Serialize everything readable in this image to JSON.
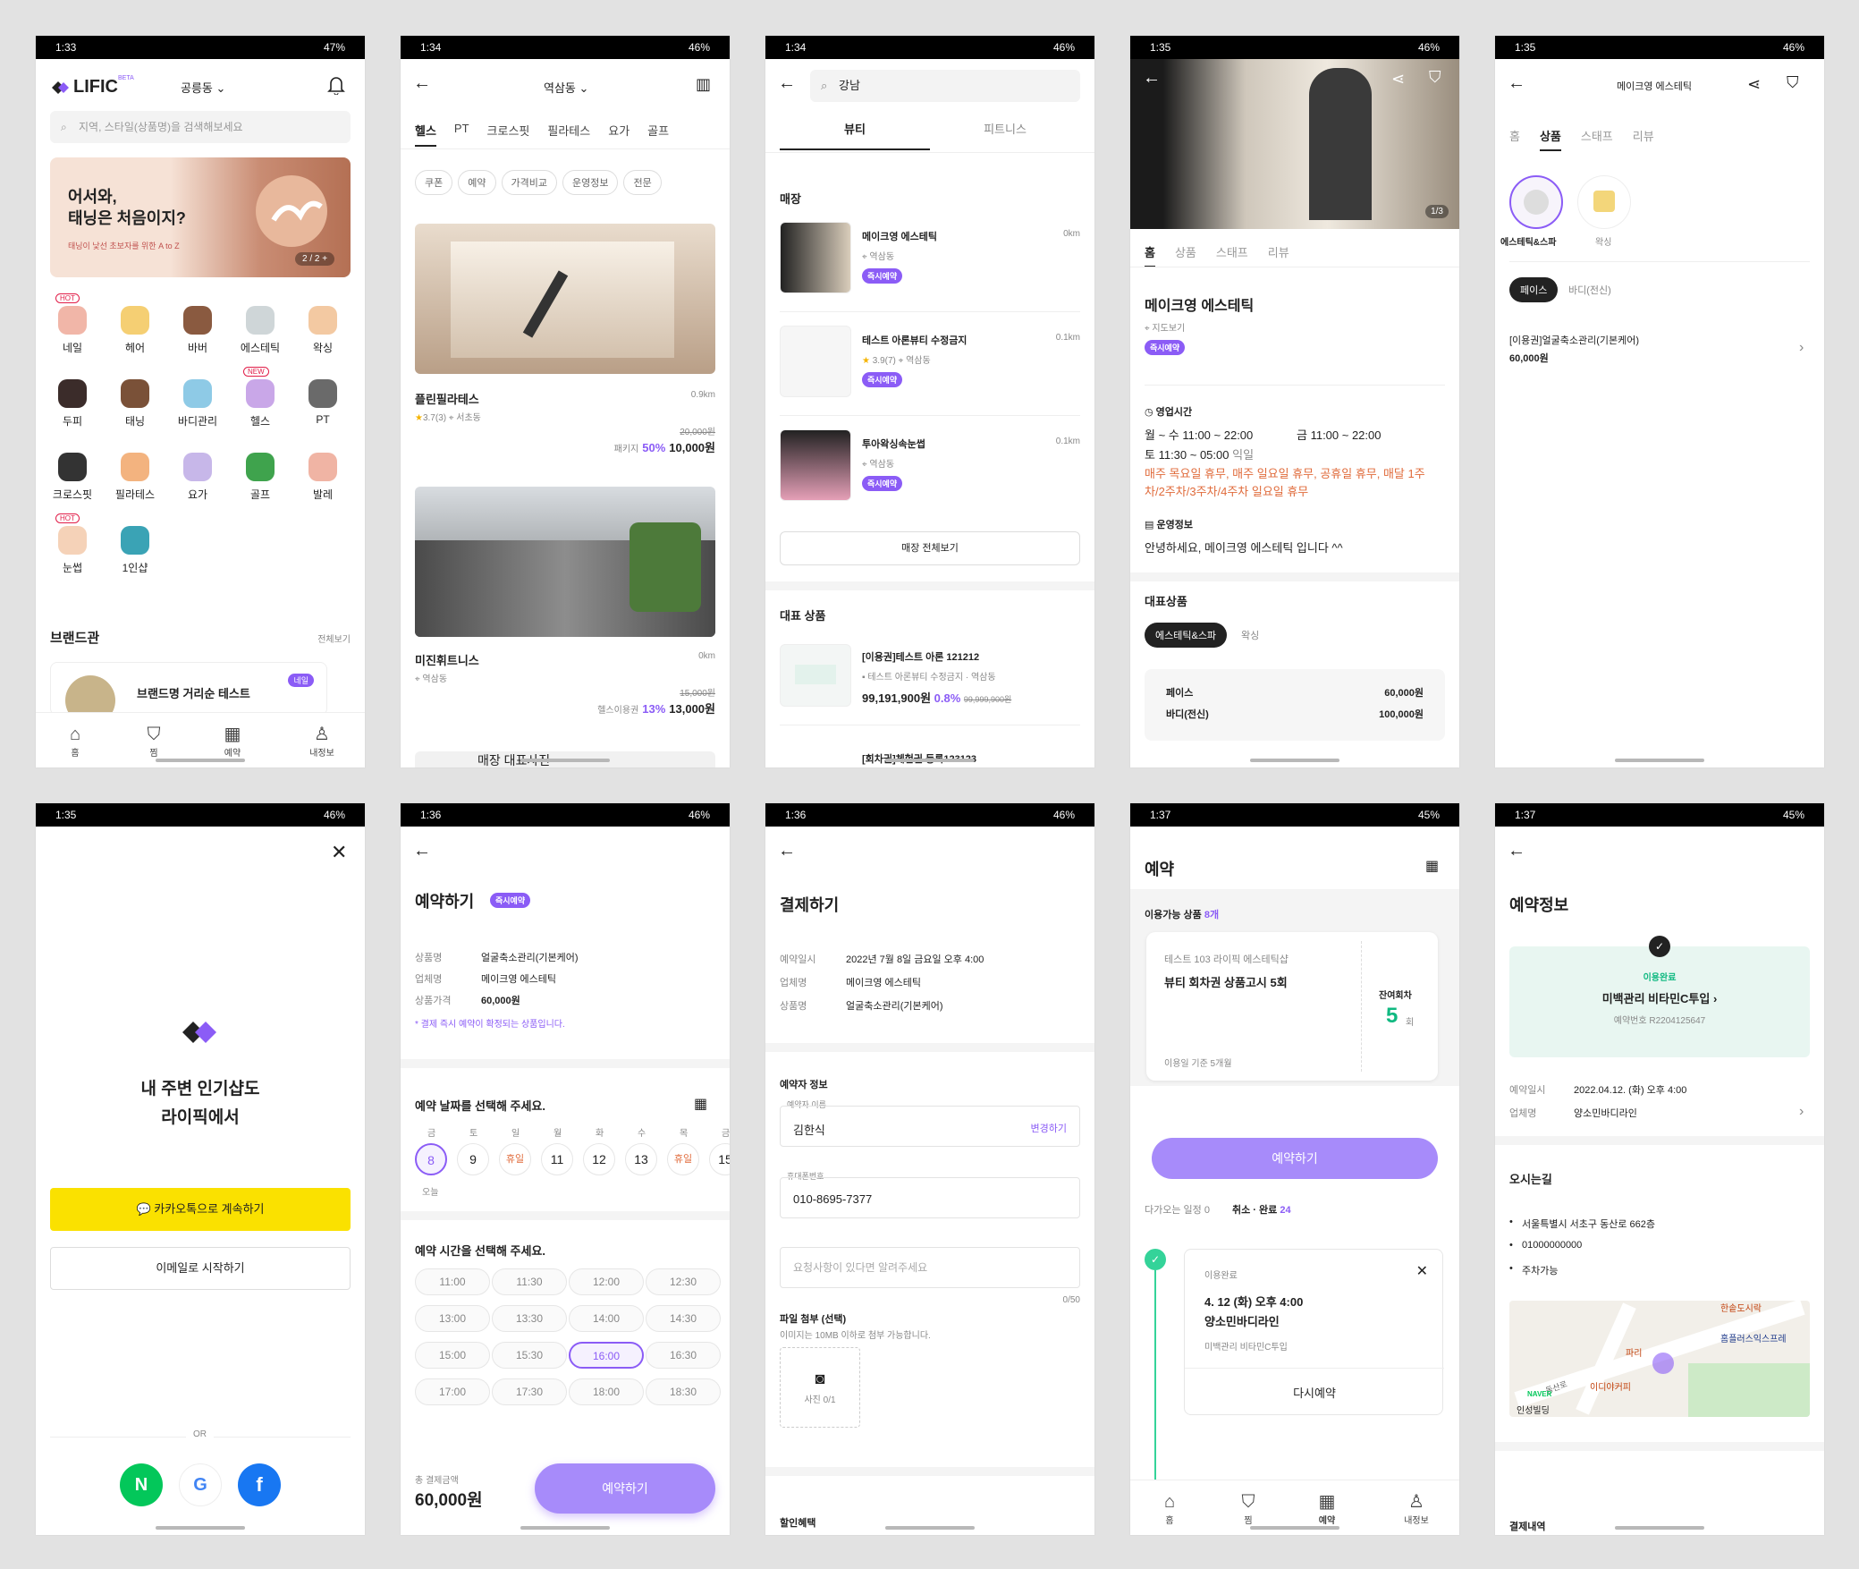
{
  "colors": {
    "accent": "#8b5cf6",
    "kakao": "#fae100",
    "naver": "#03c75a",
    "facebook": "#1877f2",
    "mint": "#e8f6f1"
  },
  "s1": {
    "status": {
      "time": "1:33",
      "battery": "47%"
    },
    "logo": "LIFIC",
    "beta": "BETA",
    "location": "공릉동",
    "search_placeholder": "지역, 스타일(상품명)을 검색해보세요",
    "banner": {
      "title1": "어서와,",
      "title2": "태닝은 처음이지?",
      "sub": "태닝이 낯선 초보자를 위한 A to Z",
      "counter": "2 / 2 +"
    },
    "cats": [
      {
        "label": "네일",
        "tag": "HOT"
      },
      {
        "label": "헤어",
        "tag": ""
      },
      {
        "label": "바버",
        "tag": ""
      },
      {
        "label": "에스테틱",
        "tag": ""
      },
      {
        "label": "왁싱",
        "tag": ""
      },
      {
        "label": "두피",
        "tag": ""
      },
      {
        "label": "태닝",
        "tag": ""
      },
      {
        "label": "바디관리",
        "tag": ""
      },
      {
        "label": "헬스",
        "tag": "NEW"
      },
      {
        "label": "PT",
        "tag": ""
      },
      {
        "label": "크로스핏",
        "tag": ""
      },
      {
        "label": "필라테스",
        "tag": ""
      },
      {
        "label": "요가",
        "tag": ""
      },
      {
        "label": "골프",
        "tag": ""
      },
      {
        "label": "발레",
        "tag": ""
      },
      {
        "label": "눈썹",
        "tag": "HOT"
      },
      {
        "label": "1인샵",
        "tag": ""
      }
    ],
    "brand_title": "브랜드관",
    "brand_all": "전체보기",
    "brand_card": "브랜드명 거리순 테스트",
    "brand_tag": "네일",
    "nav": [
      "홈",
      "찜",
      "예약",
      "내정보"
    ]
  },
  "s2": {
    "status": {
      "time": "1:34",
      "battery": "46%"
    },
    "location": "역삼동",
    "tabs": [
      "헬스",
      "PT",
      "크로스핏",
      "필라테스",
      "요가",
      "골프"
    ],
    "filters": [
      "쿠폰",
      "예약",
      "가격비교",
      "운영정보",
      "전문"
    ],
    "items": [
      {
        "name": "플린필라테스",
        "dist": "0.9km",
        "rating": "3.7(3)",
        "loc": "서초동",
        "orig": "20,000원",
        "kind": "패키지",
        "pct": "50%",
        "price": "10,000원"
      },
      {
        "name": "미진휘트니스",
        "dist": "0km",
        "rating": "",
        "loc": "역삼동",
        "orig": "15,000원",
        "kind": "헬스이용권",
        "pct": "13%",
        "price": "13,000원"
      }
    ],
    "bottom": "매장 대표사진"
  },
  "s3": {
    "status": {
      "time": "1:34",
      "battery": "46%"
    },
    "search": "강남",
    "tabs": [
      "뷰티",
      "피트니스"
    ],
    "store_title": "매장",
    "stores": [
      {
        "name": "메이크영 에스테틱",
        "dist": "0km",
        "loc": "역삼동",
        "rating": "",
        "tag": "즉시예약"
      },
      {
        "name": "테스트 아론뷰티 수정금지",
        "dist": "0.1km",
        "loc": "역삼동",
        "rating": "3.9(7)",
        "tag": "즉시예약"
      },
      {
        "name": "투아왁싱속눈썹",
        "dist": "0.1km",
        "loc": "역삼동",
        "rating": "",
        "tag": "즉시예약"
      }
    ],
    "all_btn": "매장 전체보기",
    "prod_title": "대표 상품",
    "prod": {
      "name": "[이용권]테스트 아론 121212",
      "sub": "테스트 아론뷰티 수정금지",
      "loc": "역삼동",
      "price": "99,191,900원",
      "pct": "0.8%",
      "orig": "99,999,900원"
    },
    "prod2": "[회차권]체험권 등록123123"
  },
  "s4": {
    "status": {
      "time": "1:35",
      "battery": "46%"
    },
    "counter": "1/3",
    "tabs": [
      "홈",
      "상품",
      "스태프",
      "리뷰"
    ],
    "name": "메이크영 에스테틱",
    "map": "지도보기",
    "tag": "즉시예약",
    "hours_title": "영업시간",
    "h1a": "월 ~ 수 11:00 ~ 22:00",
    "h1b": "금 11:00 ~ 22:00",
    "h2": "토 11:30 ~ 05:00",
    "h2b": "익일",
    "holiday": "매주 목요일 휴무, 매주 일요일 휴무, 공휴일 휴무, 매달 1주차/2주차/3주차/4주차 일요일 휴무",
    "info_title": "운영정보",
    "info": "안녕하세요, 메이크영 에스테틱 입니다 ^^",
    "rep_title": "대표상품",
    "chips": [
      "에스테틱&스파",
      "왁싱"
    ],
    "menu": [
      {
        "name": "페이스",
        "price": "60,000원"
      },
      {
        "name": "바디(전신)",
        "price": "100,000원"
      }
    ]
  },
  "s5": {
    "status": {
      "time": "1:35",
      "battery": "46%"
    },
    "title": "메이크영 에스테틱",
    "tabs": [
      "홈",
      "상품",
      "스태프",
      "리뷰"
    ],
    "cats": [
      "에스테틱&스파",
      "왁싱"
    ],
    "sub": [
      "페이스",
      "바디(전신)"
    ],
    "item": "[이용권]얼굴축소관리(기본케어)",
    "price": "60,000원"
  },
  "s6": {
    "status": {
      "time": "1:35",
      "battery": "46%"
    },
    "line1": "내 주변 인기샵도",
    "line2": "라이픽에서",
    "kakao": "카카오톡으로 계속하기",
    "email": "이메일로 시작하기",
    "or": "OR"
  },
  "s7": {
    "status": {
      "time": "1:36",
      "battery": "46%"
    },
    "title": "예약하기",
    "tag": "즉시예약",
    "fields": [
      {
        "k": "상품명",
        "v": "얼굴축소관리(기본케어)"
      },
      {
        "k": "업체명",
        "v": "메이크영 에스테틱"
      },
      {
        "k": "상품가격",
        "v": "60,000원"
      }
    ],
    "note": "* 결제 즉시 예약이 확정되는 상품입니다.",
    "date_title": "예약 날짜를 선택해 주세요.",
    "days": [
      "금",
      "토",
      "일",
      "월",
      "화",
      "수",
      "목",
      "금"
    ],
    "dates": [
      "8",
      "9",
      "휴일",
      "11",
      "12",
      "13",
      "휴일",
      "15"
    ],
    "today": "오늘",
    "time_title": "예약 시간을 선택해 주세요.",
    "times": [
      "11:00",
      "11:30",
      "12:00",
      "12:30",
      "13:00",
      "13:30",
      "14:00",
      "14:30",
      "15:00",
      "15:30",
      "16:00",
      "16:30",
      "17:00",
      "17:30",
      "18:00",
      "18:30"
    ],
    "total_label": "총 결제금액",
    "total": "60,000원",
    "btn": "예약하기"
  },
  "s8": {
    "status": {
      "time": "1:36",
      "battery": "46%"
    },
    "title": "결제하기",
    "fields": [
      {
        "k": "예약일시",
        "v": "2022년 7월 8일 금요일 오후 4:00"
      },
      {
        "k": "업체명",
        "v": "메이크영 에스테틱"
      },
      {
        "k": "상품명",
        "v": "얼굴축소관리(기본케어)"
      }
    ],
    "booker": "예약자 정보",
    "name_label": "예약자 이름",
    "name": "김한식",
    "change": "변경하기",
    "phone_label": "휴대폰번호",
    "phone": "010-8695-7377",
    "req_ph": "요청사항이 있다면 알려주세요",
    "count": "0/50",
    "file": "파일 첨부 (선택)",
    "file_note": "이미지는 10MB 이하로 첨부 가능합니다.",
    "photo": "사진 0/1",
    "discount": "할인혜택"
  },
  "s9": {
    "status": {
      "time": "1:37",
      "battery": "45%"
    },
    "title": "예약",
    "avail": "이용가능 상품",
    "avail_count": "8개",
    "ticket": {
      "shop": "테스트 103 라이픽 에스테틱샵",
      "name": "뷰티 회차권 상품고시 5회",
      "remain_label": "잔여회차",
      "remain": "5",
      "unit": "회",
      "period": "이용일 기준 5개월"
    },
    "btn": "예약하기",
    "upcoming": "다가오는 일정",
    "up_n": "0",
    "done": "취소 · 완료",
    "done_n": "24",
    "card": {
      "status": "이용완료",
      "date": "4. 12 (화) 오후 4:00",
      "shop": "양소민바디라인",
      "prod": "미백관리 비타민C투입",
      "again": "다시예약"
    },
    "nav": [
      "홈",
      "찜",
      "예약",
      "내정보"
    ]
  },
  "s10": {
    "status": {
      "time": "1:37",
      "battery": "45%"
    },
    "title": "예약정보",
    "state": "이용완료",
    "prod": "미백관리 비타민C투입",
    "num": "예약번호 R2204125647",
    "fields": [
      {
        "k": "예약일시",
        "v": "2022.04.12. (화) 오후 4:00"
      },
      {
        "k": "업체명",
        "v": "양소민바디라인"
      }
    ],
    "way": "오시는길",
    "addr": [
      "서울특별시 서초구 동산로 662층",
      "01000000000",
      "주차가능"
    ],
    "map_labels": [
      "한솥도시락",
      "홈플러스익스프레",
      "파리",
      "이디야커피",
      "동산로",
      "인성빌딩",
      "NAVER"
    ],
    "pay": "결제내역"
  }
}
